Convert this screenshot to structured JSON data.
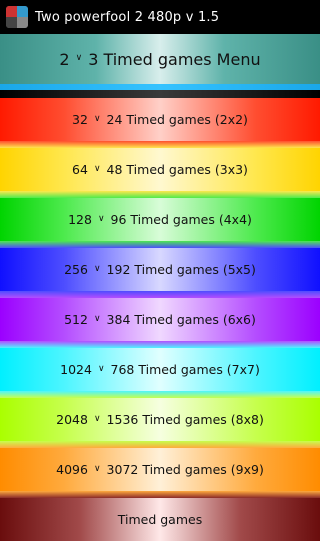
{
  "app": {
    "title": "Two powerfool 2 480p v 1.5"
  },
  "header": {
    "left": "2",
    "right": "3 Timed games Menu"
  },
  "menu": [
    {
      "a": "32",
      "b": "24 Timed games (2x2)"
    },
    {
      "a": "64",
      "b": "48 Timed games (3x3)"
    },
    {
      "a": "128",
      "b": "96 Timed games (4x4)"
    },
    {
      "a": "256",
      "b": "192 Timed games (5x5)"
    },
    {
      "a": "512",
      "b": "384 Timed games (6x6)"
    },
    {
      "a": "1024",
      "b": "768 Timed games (7x7)"
    },
    {
      "a": "2048",
      "b": "1536 Timed games (8x8)"
    },
    {
      "a": "4096",
      "b": "3072 Timed games (9x9)"
    }
  ],
  "footer": {
    "label": "Timed games"
  }
}
